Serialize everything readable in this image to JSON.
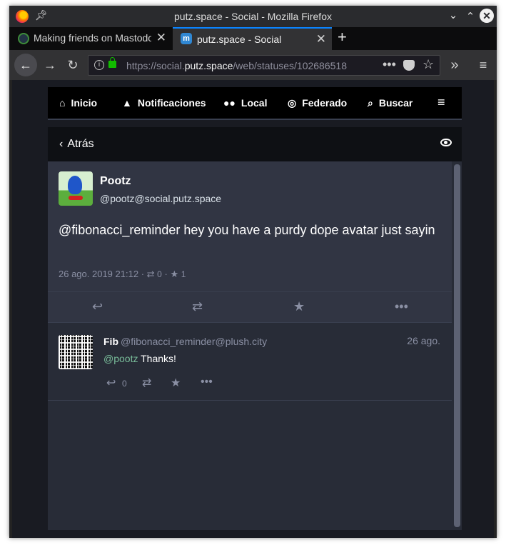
{
  "window": {
    "title": "putz.space - Social - Mozilla Firefox"
  },
  "tabs": [
    {
      "label": "Making friends on Mastodon",
      "active": false
    },
    {
      "label": "putz.space - Social",
      "active": true
    }
  ],
  "urlbar": {
    "prefix": "https://social.",
    "domain": "putz.space",
    "path": "/web/statuses/102686518"
  },
  "colnav": {
    "items": [
      {
        "label": "Inicio",
        "icon": "home-icon"
      },
      {
        "label": "Notificaciones",
        "icon": "bell-icon"
      },
      {
        "label": "Local",
        "icon": "users-icon"
      },
      {
        "label": "Federado",
        "icon": "globe-icon"
      },
      {
        "label": "Buscar",
        "icon": "search-icon"
      }
    ]
  },
  "colhead": {
    "back_label": "Atrás"
  },
  "status": {
    "display_name": "Pootz",
    "acct": "@pootz@social.putz.space",
    "text": "@fibonacci_reminder hey you have a purdy dope avatar just sayin",
    "date": "26 ago. 2019 21:12",
    "reblogs": "0",
    "favourites": "1"
  },
  "reply": {
    "display_name": "Fib",
    "acct": "@fibonacci_reminder@plush.city",
    "time": "26 ago.",
    "mention": "@pootz",
    "text": " Thanks!",
    "reply_count": "0"
  },
  "colors": {
    "accent": "#0a84ff",
    "mention": "#79bd9a",
    "muted": "#8a8fa3"
  }
}
